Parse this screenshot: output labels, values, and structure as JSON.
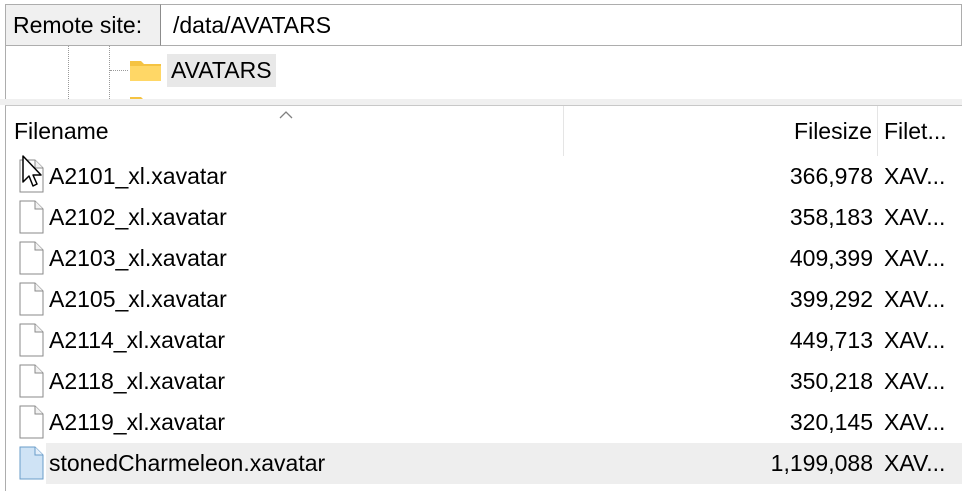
{
  "remote_site": {
    "label": "Remote site:",
    "path": "/data/AVATARS"
  },
  "tree": {
    "items": [
      {
        "label": "AVATARS",
        "icon": "folder-icon"
      }
    ]
  },
  "file_list": {
    "columns": {
      "filename": "Filename",
      "filesize": "Filesize",
      "filetype": "Filet..."
    },
    "sort": {
      "column": "filename",
      "direction": "ascending"
    },
    "rows": [
      {
        "name": "A2101_xl.xavatar",
        "size": "366,978",
        "type": "XAV...",
        "icon": "file-icon"
      },
      {
        "name": "A2102_xl.xavatar",
        "size": "358,183",
        "type": "XAV...",
        "icon": "file-icon"
      },
      {
        "name": "A2103_xl.xavatar",
        "size": "409,399",
        "type": "XAV...",
        "icon": "file-icon"
      },
      {
        "name": "A2105_xl.xavatar",
        "size": "399,292",
        "type": "XAV...",
        "icon": "file-icon"
      },
      {
        "name": "A2114_xl.xavatar",
        "size": "449,713",
        "type": "XAV...",
        "icon": "file-icon"
      },
      {
        "name": "A2118_xl.xavatar",
        "size": "350,218",
        "type": "XAV...",
        "icon": "file-icon"
      },
      {
        "name": "A2119_xl.xavatar",
        "size": "320,145",
        "type": "XAV...",
        "icon": "file-icon"
      },
      {
        "name": "stonedCharmeleon.xavatar",
        "size": "1,199,088",
        "type": "XAV...",
        "icon": "file-icon-selected",
        "selected": true
      }
    ]
  },
  "colors": {
    "folder": "#f5c342",
    "selected_row": "#eeeeee",
    "selected_file_icon": "#cfe3f5"
  }
}
